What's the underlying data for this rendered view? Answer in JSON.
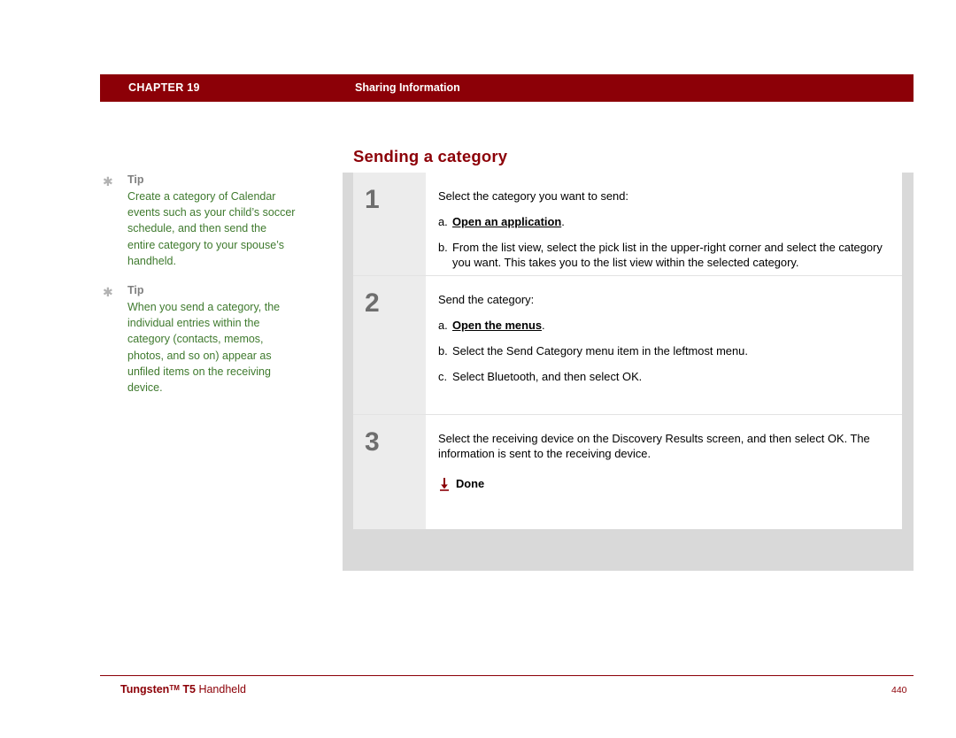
{
  "header": {
    "chapter": "CHAPTER 19",
    "section": "Sharing Information",
    "bar_color": "#8c0007"
  },
  "page_title": "Sending a category",
  "tips": [
    {
      "label": "Tip",
      "text": "Create a category of Calendar events such as your child’s soccer schedule, and then send the entire category to your spouse’s handheld."
    },
    {
      "label": "Tip",
      "text": "When you send a category, the individual entries within the category (contacts, memos, photos, and so on) appear as unfiled items on the receiving device."
    }
  ],
  "steps": [
    {
      "number": "1",
      "lead": "Select the category you want to send:",
      "subs": [
        {
          "letter": "a.",
          "link": "Open an application",
          "tail": "."
        },
        {
          "letter": "b.",
          "text": "From the list view, select the pick list in the upper-right corner and select the category you want. This takes you to the list view within the selected category."
        }
      ]
    },
    {
      "number": "2",
      "lead": "Send the category:",
      "subs": [
        {
          "letter": "a.",
          "link": "Open the menus",
          "tail": "."
        },
        {
          "letter": "b.",
          "text": "Select the Send Category menu item in the leftmost menu."
        },
        {
          "letter": "c.",
          "text": "Select Bluetooth, and then select OK."
        }
      ]
    },
    {
      "number": "3",
      "lead": "Select the receiving device on the Discovery Results screen, and then select OK. The information is sent to the receiving device.",
      "done_label": "Done",
      "done_icon": "down-arrow-icon"
    }
  ],
  "footer": {
    "product": "Tungsten",
    "trademark": "TM",
    "model": "T5",
    "device": "Handheld",
    "page_number": "440"
  }
}
